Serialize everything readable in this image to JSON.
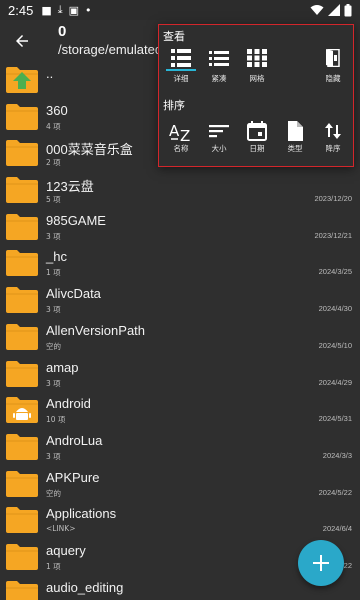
{
  "status_bar": {
    "time": "2:45"
  },
  "header": {
    "count": "0",
    "path": "/storage/emulated/0"
  },
  "files": [
    {
      "name": "..",
      "sub": "",
      "date": "",
      "icon": "folder-up-icon"
    },
    {
      "name": "360",
      "sub": "4 项",
      "date": ""
    },
    {
      "name": "000菜菜音乐盒",
      "sub": "2 项",
      "date": ""
    },
    {
      "name": "123云盘",
      "sub": "5 项",
      "date": "2023/12/20"
    },
    {
      "name": "985GAME",
      "sub": "3 项",
      "date": "2023/12/21"
    },
    {
      "name": "_hc",
      "sub": "1 项",
      "date": "2024/3/25"
    },
    {
      "name": "AlivcData",
      "sub": "3 项",
      "date": "2024/4/30"
    },
    {
      "name": "AllenVersionPath",
      "sub": "空的",
      "date": "2024/5/10"
    },
    {
      "name": "amap",
      "sub": "3 项",
      "date": "2024/4/29"
    },
    {
      "name": "Android",
      "sub": "10 项",
      "date": "2024/5/31",
      "icon": "android-folder-icon"
    },
    {
      "name": "AndroLua",
      "sub": "3 项",
      "date": "2024/3/3"
    },
    {
      "name": "APKPure",
      "sub": "空的",
      "date": "2024/5/22"
    },
    {
      "name": "Applications",
      "sub": "<LINK>",
      "date": "2024/6/4"
    },
    {
      "name": "aquery",
      "sub": "1 项",
      "date": "2023/12/22"
    },
    {
      "name": "audio_editing",
      "sub": "",
      "date": ""
    }
  ],
  "menu": {
    "view_title": "查看",
    "view_options": [
      {
        "label": "详细",
        "icon": "view-detail-icon",
        "selected": true
      },
      {
        "label": "紧凑",
        "icon": "view-compact-icon",
        "selected": false
      },
      {
        "label": "网格",
        "icon": "view-grid-icon",
        "selected": false
      },
      {
        "label": "隐藏",
        "icon": "hidden-files-icon",
        "selected": false
      }
    ],
    "sort_title": "排序",
    "sort_options": [
      {
        "label": "名称",
        "icon": "sort-name-icon"
      },
      {
        "label": "大小",
        "icon": "sort-size-icon"
      },
      {
        "label": "日期",
        "icon": "sort-date-icon"
      },
      {
        "label": "类型",
        "icon": "sort-type-icon"
      },
      {
        "label": "降序",
        "icon": "sort-descending-icon"
      }
    ]
  },
  "colors": {
    "folder": "#f5a623",
    "accent": "#29b6d6",
    "fab": "#2aa8c9",
    "popup_border": "#d3262b",
    "background": "#2f2f2f"
  }
}
